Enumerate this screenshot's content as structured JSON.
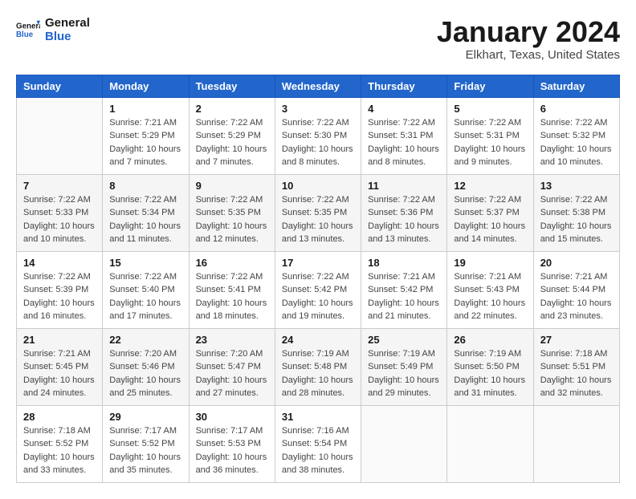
{
  "logo": {
    "line1": "General",
    "line2": "Blue"
  },
  "title": "January 2024",
  "location": "Elkhart, Texas, United States",
  "weekdays": [
    "Sunday",
    "Monday",
    "Tuesday",
    "Wednesday",
    "Thursday",
    "Friday",
    "Saturday"
  ],
  "weeks": [
    [
      {
        "day": "",
        "info": ""
      },
      {
        "day": "1",
        "info": "Sunrise: 7:21 AM\nSunset: 5:29 PM\nDaylight: 10 hours\nand 7 minutes."
      },
      {
        "day": "2",
        "info": "Sunrise: 7:22 AM\nSunset: 5:29 PM\nDaylight: 10 hours\nand 7 minutes."
      },
      {
        "day": "3",
        "info": "Sunrise: 7:22 AM\nSunset: 5:30 PM\nDaylight: 10 hours\nand 8 minutes."
      },
      {
        "day": "4",
        "info": "Sunrise: 7:22 AM\nSunset: 5:31 PM\nDaylight: 10 hours\nand 8 minutes."
      },
      {
        "day": "5",
        "info": "Sunrise: 7:22 AM\nSunset: 5:31 PM\nDaylight: 10 hours\nand 9 minutes."
      },
      {
        "day": "6",
        "info": "Sunrise: 7:22 AM\nSunset: 5:32 PM\nDaylight: 10 hours\nand 10 minutes."
      }
    ],
    [
      {
        "day": "7",
        "info": "Sunrise: 7:22 AM\nSunset: 5:33 PM\nDaylight: 10 hours\nand 10 minutes."
      },
      {
        "day": "8",
        "info": "Sunrise: 7:22 AM\nSunset: 5:34 PM\nDaylight: 10 hours\nand 11 minutes."
      },
      {
        "day": "9",
        "info": "Sunrise: 7:22 AM\nSunset: 5:35 PM\nDaylight: 10 hours\nand 12 minutes."
      },
      {
        "day": "10",
        "info": "Sunrise: 7:22 AM\nSunset: 5:35 PM\nDaylight: 10 hours\nand 13 minutes."
      },
      {
        "day": "11",
        "info": "Sunrise: 7:22 AM\nSunset: 5:36 PM\nDaylight: 10 hours\nand 13 minutes."
      },
      {
        "day": "12",
        "info": "Sunrise: 7:22 AM\nSunset: 5:37 PM\nDaylight: 10 hours\nand 14 minutes."
      },
      {
        "day": "13",
        "info": "Sunrise: 7:22 AM\nSunset: 5:38 PM\nDaylight: 10 hours\nand 15 minutes."
      }
    ],
    [
      {
        "day": "14",
        "info": "Sunrise: 7:22 AM\nSunset: 5:39 PM\nDaylight: 10 hours\nand 16 minutes."
      },
      {
        "day": "15",
        "info": "Sunrise: 7:22 AM\nSunset: 5:40 PM\nDaylight: 10 hours\nand 17 minutes."
      },
      {
        "day": "16",
        "info": "Sunrise: 7:22 AM\nSunset: 5:41 PM\nDaylight: 10 hours\nand 18 minutes."
      },
      {
        "day": "17",
        "info": "Sunrise: 7:22 AM\nSunset: 5:42 PM\nDaylight: 10 hours\nand 19 minutes."
      },
      {
        "day": "18",
        "info": "Sunrise: 7:21 AM\nSunset: 5:42 PM\nDaylight: 10 hours\nand 21 minutes."
      },
      {
        "day": "19",
        "info": "Sunrise: 7:21 AM\nSunset: 5:43 PM\nDaylight: 10 hours\nand 22 minutes."
      },
      {
        "day": "20",
        "info": "Sunrise: 7:21 AM\nSunset: 5:44 PM\nDaylight: 10 hours\nand 23 minutes."
      }
    ],
    [
      {
        "day": "21",
        "info": "Sunrise: 7:21 AM\nSunset: 5:45 PM\nDaylight: 10 hours\nand 24 minutes."
      },
      {
        "day": "22",
        "info": "Sunrise: 7:20 AM\nSunset: 5:46 PM\nDaylight: 10 hours\nand 25 minutes."
      },
      {
        "day": "23",
        "info": "Sunrise: 7:20 AM\nSunset: 5:47 PM\nDaylight: 10 hours\nand 27 minutes."
      },
      {
        "day": "24",
        "info": "Sunrise: 7:19 AM\nSunset: 5:48 PM\nDaylight: 10 hours\nand 28 minutes."
      },
      {
        "day": "25",
        "info": "Sunrise: 7:19 AM\nSunset: 5:49 PM\nDaylight: 10 hours\nand 29 minutes."
      },
      {
        "day": "26",
        "info": "Sunrise: 7:19 AM\nSunset: 5:50 PM\nDaylight: 10 hours\nand 31 minutes."
      },
      {
        "day": "27",
        "info": "Sunrise: 7:18 AM\nSunset: 5:51 PM\nDaylight: 10 hours\nand 32 minutes."
      }
    ],
    [
      {
        "day": "28",
        "info": "Sunrise: 7:18 AM\nSunset: 5:52 PM\nDaylight: 10 hours\nand 33 minutes."
      },
      {
        "day": "29",
        "info": "Sunrise: 7:17 AM\nSunset: 5:52 PM\nDaylight: 10 hours\nand 35 minutes."
      },
      {
        "day": "30",
        "info": "Sunrise: 7:17 AM\nSunset: 5:53 PM\nDaylight: 10 hours\nand 36 minutes."
      },
      {
        "day": "31",
        "info": "Sunrise: 7:16 AM\nSunset: 5:54 PM\nDaylight: 10 hours\nand 38 minutes."
      },
      {
        "day": "",
        "info": ""
      },
      {
        "day": "",
        "info": ""
      },
      {
        "day": "",
        "info": ""
      }
    ]
  ]
}
